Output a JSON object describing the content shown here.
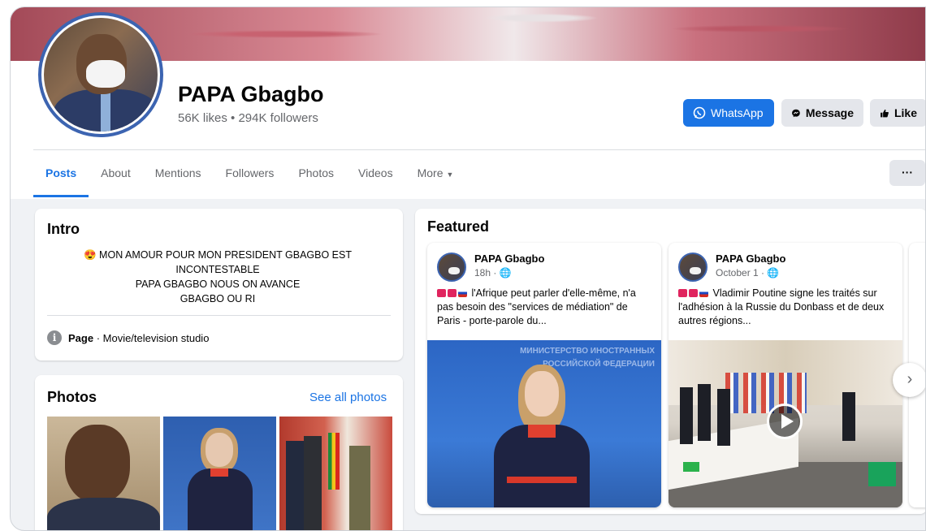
{
  "page": {
    "name": "PAPA Gbagbo",
    "stats": "56K likes • 294K followers"
  },
  "actions": {
    "whatsapp_label": "WhatsApp",
    "message_label": "Message",
    "like_label": "Like",
    "more_dots": "···"
  },
  "tabs": [
    {
      "label": "Posts",
      "active": true
    },
    {
      "label": "About"
    },
    {
      "label": "Mentions"
    },
    {
      "label": "Followers"
    },
    {
      "label": "Photos"
    },
    {
      "label": "Videos"
    },
    {
      "label": "More"
    }
  ],
  "intro": {
    "title": "Intro",
    "bio_lines": [
      "😍 MON AMOUR POUR MON PRESIDENT GBAGBO EST",
      "INCONTESTABLE",
      "PAPA GBAGBO NOUS ON AVANCE",
      "GBAGBO OU RI"
    ],
    "category_label": "Page",
    "category_value": " · Movie/television studio"
  },
  "photos": {
    "title": "Photos",
    "see_all": "See all photos"
  },
  "featured": {
    "title": "Featured",
    "posts": [
      {
        "author": "PAPA Gbagbo",
        "time": "18h · 🌐",
        "text": "l'Afrique peut parler d'elle-même, n'a pas besoin des \"services de médiation\" de Paris - porte-parole du...",
        "media_banner": "МИНИСТЕРСТВО ИНОСТРАННЫХ РОССИЙСКОЙ ФЕДЕРАЦИИ"
      },
      {
        "author": "PAPA Gbagbo",
        "time": "October 1 · 🌐",
        "text": "Vladimir Poutine signe les traités sur l'adhésion à la Russie du Donbass et de deux autres régions...",
        "has_video": true
      }
    ]
  },
  "colors": {
    "accent": "#1b74e4",
    "avatar_ring": "#3c64b1"
  },
  "icons": {
    "whatsapp": "whatsapp-icon",
    "message": "messenger-icon",
    "like": "thumbs-up-icon",
    "info": "info-icon",
    "next": "chevron-right-icon",
    "globe": "globe-icon",
    "play": "play-icon"
  }
}
